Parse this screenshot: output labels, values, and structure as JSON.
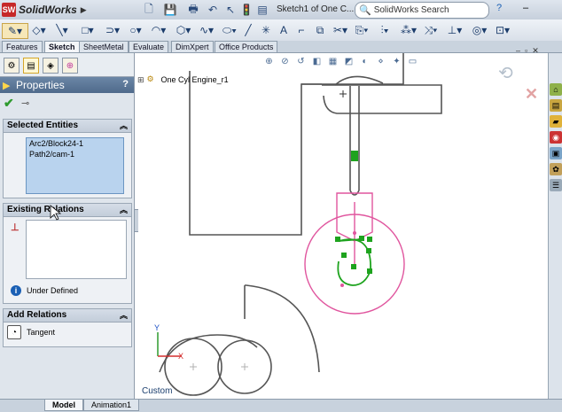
{
  "app": {
    "name": "SolidWorks",
    "logo_badge": "SW"
  },
  "window": {
    "doc_title": "Sketch1 of One C..."
  },
  "search": {
    "placeholder": "SolidWorks Search"
  },
  "tabs": [
    {
      "label": "Features",
      "active": false
    },
    {
      "label": "Sketch",
      "active": true
    },
    {
      "label": "SheetMetal",
      "active": false
    },
    {
      "label": "Evaluate",
      "active": false
    },
    {
      "label": "DimXpert",
      "active": false
    },
    {
      "label": "Office Products",
      "active": false
    }
  ],
  "panel": {
    "title": "Properties",
    "help": "?",
    "selected_entities": {
      "header": "Selected Entities",
      "items": [
        "Arc2/Block24-1",
        "Path2/cam-1"
      ]
    },
    "existing_relations": {
      "header": "Existing Relations",
      "status": "Under Defined"
    },
    "add_relations": {
      "header": "Add Relations",
      "button": "Tangent"
    }
  },
  "tree": {
    "root": "One Cyl Engine_r1"
  },
  "graphics": {
    "corner_label": "Custom"
  },
  "bottom_tabs": [
    {
      "label": "Model",
      "active": true
    },
    {
      "label": "Animation1",
      "active": false
    }
  ],
  "colors": {
    "sketch_gray": "#555555",
    "block_pink": "#e0559e",
    "selected_green": "#1ea31e",
    "axis_red": "#d32f2f",
    "axis_green": "#2e9a2e",
    "axis_blue": "#1a4fc4"
  }
}
